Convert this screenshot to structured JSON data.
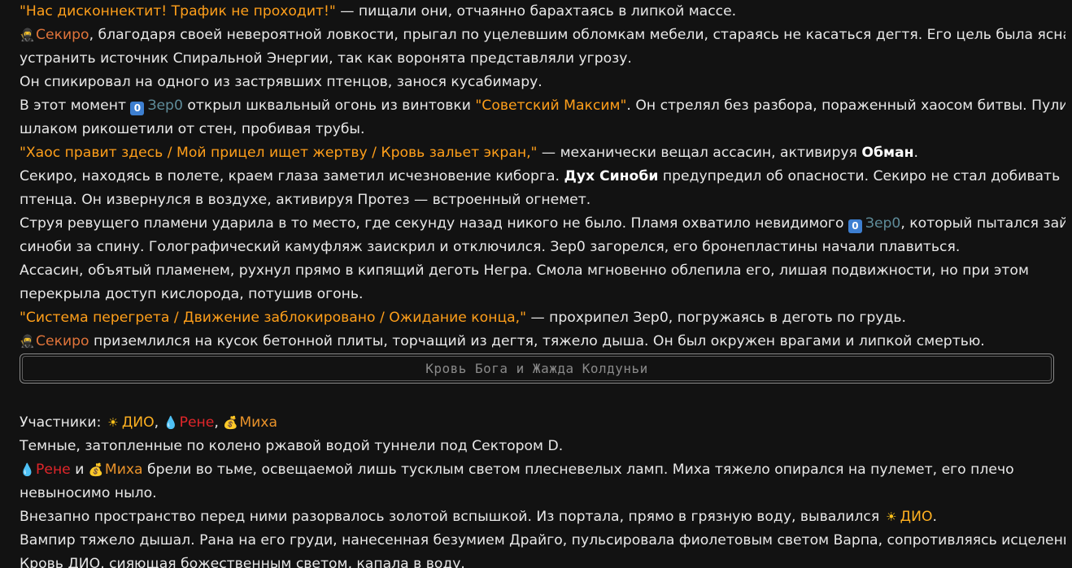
{
  "part1": {
    "l1": {
      "quote": "\"Нас дисконнектит! Трафик не проходит!\"",
      "rest": " — пищали они, отчаянно барахтаясь в липкой массе."
    },
    "l2": {
      "name": "Секиро",
      "rest": ", благодаря своей невероятной ловкости, прыгал по уцелевшим обломкам мебели, стараясь не касаться дегтя. Его цель была ясна —"
    },
    "l3": "устранить источник Спиральной Энергии, так как воронята представляли угрозу.",
    "l4": "Он спикировал на одного из застрявших птенцов, занося кусабимару.",
    "l5": {
      "pre": "В этот момент ",
      "zero_badge": "0",
      "name": "Зер0",
      "mid": " открыл шквальный огонь из винтовки ",
      "quote": "\"Советский Максим\"",
      "rest": ". Он стрелял без разбора, пораженный хаосом битвы. Пули со"
    },
    "l6": "шлаком рикошетили от стен, пробивая трубы.",
    "l7": {
      "quote": "\"Хаос правит здесь / Мой прицел ищет жертву / Кровь зальет экран,\"",
      "mid": " — механически вещал ассасин, активируя ",
      "bold": "Обман",
      "end": "."
    },
    "l8": {
      "pre": "Секиро, находясь в полете, краем глаза заметил исчезновение киборга. ",
      "bold": "Дух Синоби",
      "rest": " предупредил об опасности. Секиро не стал добивать"
    },
    "l9": "птенца. Он извернулся в воздухе, активируя Протез — встроенный огнемет.",
    "l10": {
      "pre": "Струя ревущего пламени ударила в то место, где секунду назад никого не было. Пламя охватило невидимого ",
      "zero_badge": "0",
      "name": "Зер0",
      "rest": ", который пытался зайти"
    },
    "l11": "синоби за спину. Голографический камуфляж заискрил и отключился. Зер0 загорелся, его бронепластины начали плавиться.",
    "l12": "Ассасин, объятый пламенем, рухнул прямо в кипящий деготь Негра. Смола мгновенно облепила его, лишая подвижности, но при этом",
    "l13": "перекрыла доступ кислорода, потушив огонь.",
    "l14": {
      "quote": "\"Система перегрета / Движение заблокировано / Ожидание конца,\"",
      "rest": " — прохрипел Зер0, погружаясь в деготь по грудь."
    },
    "l15": {
      "name": "Секиро",
      "rest": " приземлился на кусок бетонной плиты, торчащий из дегтя, тяжело дыша. Он был окружен врагами и липкой смертью."
    }
  },
  "divider": {
    "title": "Кровь Бога и Жажда Колдуньи"
  },
  "part2": {
    "participants": {
      "label": "Участники: ",
      "dio": "ДИО",
      "sep1": ", ",
      "rene": "Рене",
      "sep2": ", ",
      "miha": "Миха"
    },
    "l2": "Темные, затопленные по колено ржавой водой туннели под Сектором D.",
    "l3": {
      "rene": "Рене",
      "and": " и ",
      "miha": "Миха",
      "rest": " брели во тьме, освещаемой лишь тусклым светом плесневелых ламп. Миха тяжело опирался на пулемет, его плечо"
    },
    "l4": "невыносимо ныло.",
    "l5": {
      "pre": "Внезапно пространство перед ними разорвалось золотой вспышкой. Из портала, прямо в грязную воду, вывалился ",
      "dio": "ДИО",
      "end": "."
    },
    "l6": "Вампир тяжело дышал. Рана на его груди, нанесенная безумием Драйго, пульсировала фиолетовым светом Варпа, сопротивляясь исцелению.",
    "l7": "Кровь ДИО, сияющая божественным светом, капала в воду."
  },
  "icons": {
    "ninja": "ninja-icon",
    "zero": "keycap-zero-icon",
    "sun": "sun-icon",
    "drop": "blood-drop-icon",
    "bag": "money-bag-icon"
  },
  "colors": {
    "background": "#121212",
    "text": "#e8e8e8",
    "quote": "#ff9f1a",
    "sekiro": "#e0743a",
    "zer0": "#5f8c9a",
    "dio": "#ffb020",
    "rene": "#e0262a",
    "miha": "#e8922a",
    "divider_border": "#8a8a8a"
  }
}
